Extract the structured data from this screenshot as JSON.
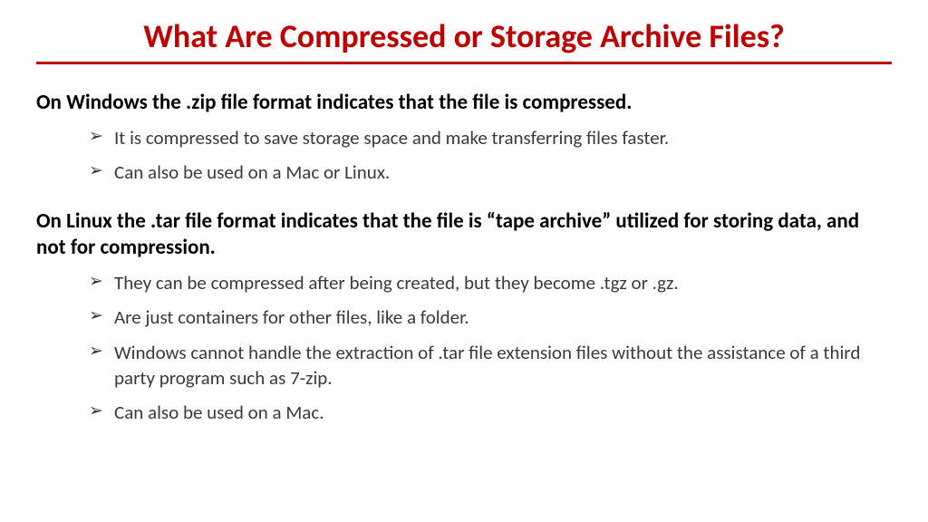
{
  "title": "What Are Compressed or Storage Archive Files?",
  "sections": [
    {
      "heading": "On Windows the .zip file format indicates that the file is compressed.",
      "bullets": [
        "It is compressed to save storage space and make transferring files faster.",
        "Can also be used on a Mac or Linux."
      ]
    },
    {
      "heading": "On Linux the .tar file format indicates that the file is “tape archive” utilized for storing data, and not for compression.",
      "bullets": [
        "They can be compressed after being created, but they become .tgz or .gz.",
        "Are just containers for other files, like a folder.",
        "Windows cannot handle the extraction of .tar file extension files without the assistance of a third party program such as 7-zip.",
        "Can also be used on a Mac."
      ]
    }
  ]
}
